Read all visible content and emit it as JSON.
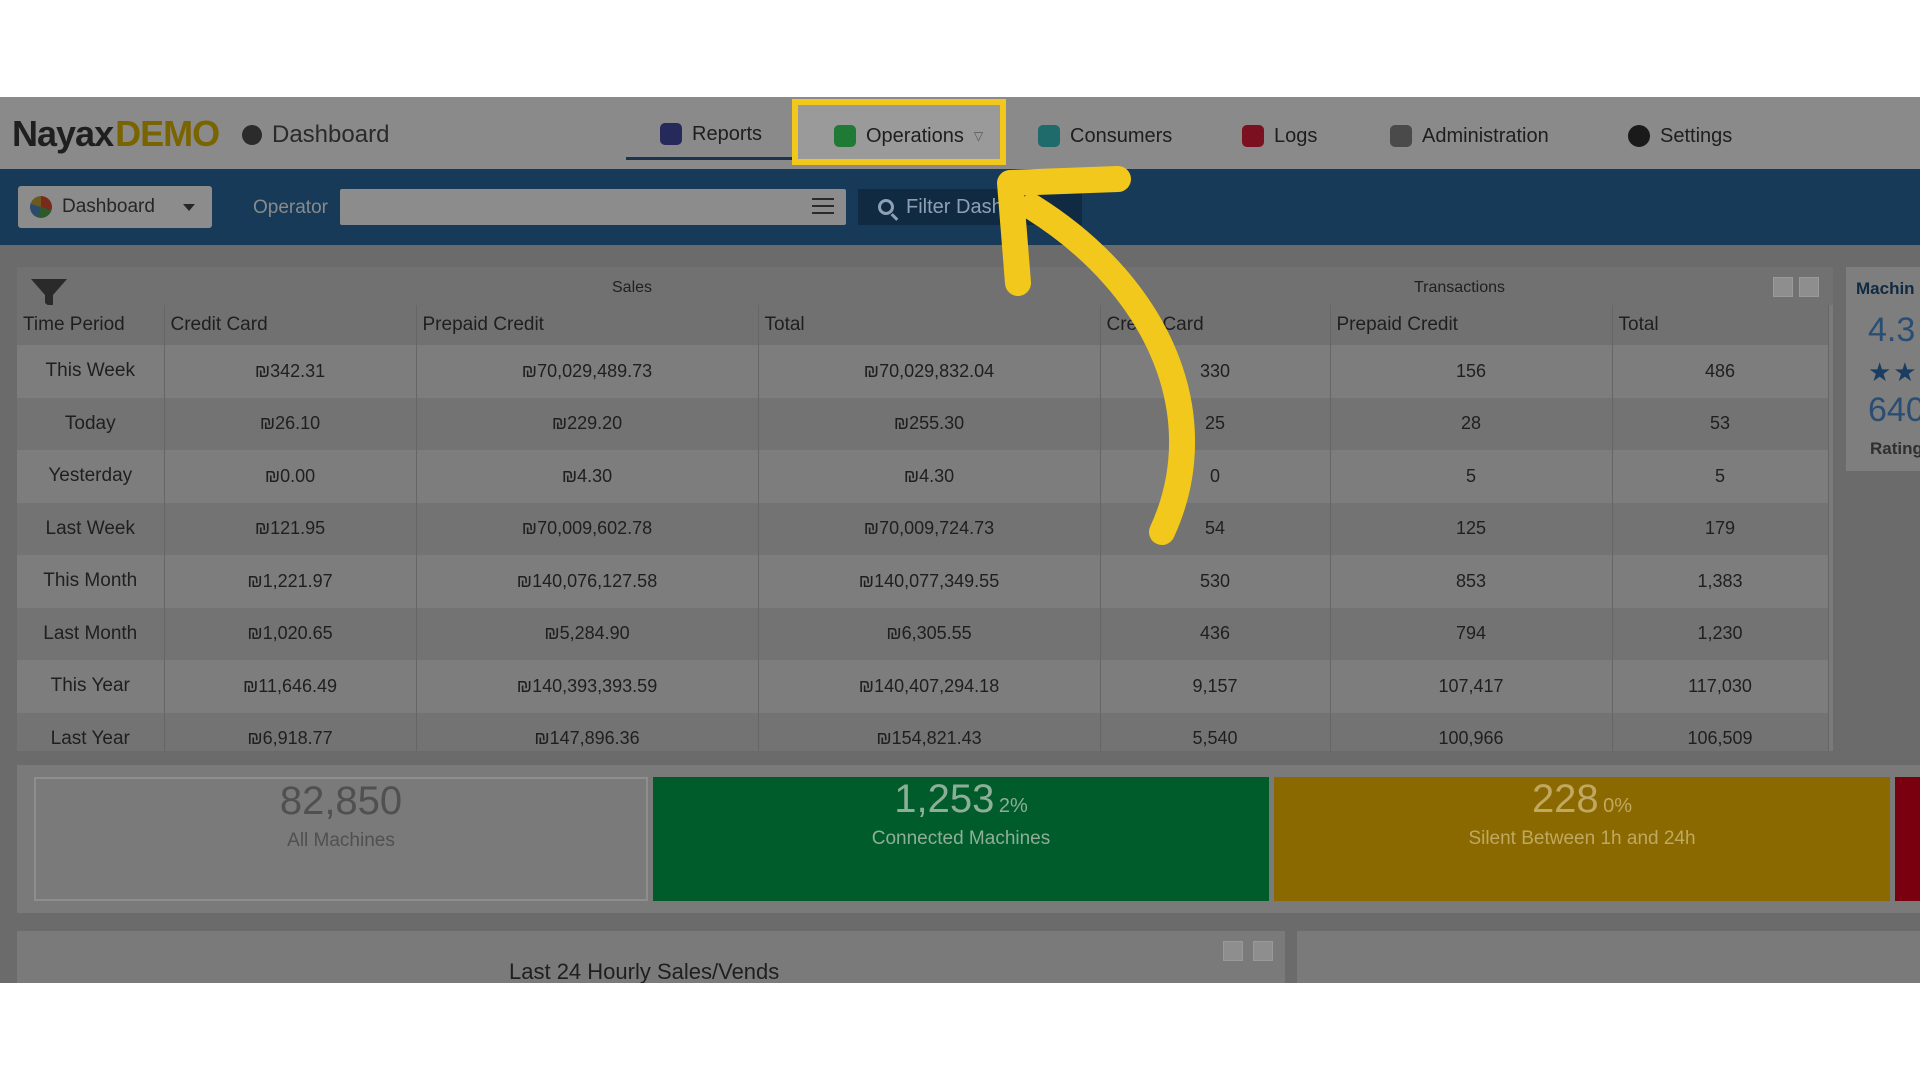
{
  "header": {
    "logo_main": "Nayax",
    "logo_suffix": "DEMO",
    "breadcrumb": "Dashboard"
  },
  "nav": {
    "reports": "Reports",
    "operations": "Operations",
    "consumers": "Consumers",
    "logs": "Logs",
    "administration": "Administration",
    "settings": "Settings"
  },
  "filterbar": {
    "dashboard_button": "Dashboard",
    "operator_label": "Operator",
    "operator_value": "",
    "filter_button": "Filter Dash"
  },
  "table": {
    "group_sales": "Sales",
    "group_transactions": "Transactions",
    "columns": [
      "Time Period",
      "Credit Card",
      "Prepaid Credit",
      "Total",
      "Credit Card",
      "Prepaid Credit",
      "Total"
    ],
    "rows": [
      [
        "This Week",
        "₪342.31",
        "₪70,029,489.73",
        "₪70,029,832.04",
        "330",
        "156",
        "486"
      ],
      [
        "Today",
        "₪26.10",
        "₪229.20",
        "₪255.30",
        "25",
        "28",
        "53"
      ],
      [
        "Yesterday",
        "₪0.00",
        "₪4.30",
        "₪4.30",
        "0",
        "5",
        "5"
      ],
      [
        "Last Week",
        "₪121.95",
        "₪70,009,602.78",
        "₪70,009,724.73",
        "54",
        "125",
        "179"
      ],
      [
        "This Month",
        "₪1,221.97",
        "₪140,076,127.58",
        "₪140,077,349.55",
        "530",
        "853",
        "1,383"
      ],
      [
        "Last Month",
        "₪1,020.65",
        "₪5,284.90",
        "₪6,305.55",
        "436",
        "794",
        "1,230"
      ],
      [
        "This Year",
        "₪11,646.49",
        "₪140,393,393.59",
        "₪140,407,294.18",
        "9,157",
        "107,417",
        "117,030"
      ],
      [
        "Last Year",
        "₪6,918.77",
        "₪147,896.36",
        "₪154,821.43",
        "5,540",
        "100,966",
        "106,509"
      ]
    ]
  },
  "rating": {
    "title": "Machin",
    "value": "4.3",
    "stars": "★★",
    "count": "640",
    "label": "Rating"
  },
  "cards": [
    {
      "number": "82,850",
      "percent": "",
      "label": "All Machines",
      "bg": "#7a7a7a",
      "color": "#505050"
    },
    {
      "number": "1,253",
      "percent": "2%",
      "label": "Connected Machines",
      "bg": "#005c2a",
      "color": "#8fae99"
    },
    {
      "number": "228",
      "percent": "0%",
      "label": "Silent Between 1h and 24h",
      "bg": "#8a6a00",
      "color": "#c0a860"
    }
  ],
  "bottom": {
    "chart_title": "Last 24 Hourly Sales/Vends"
  },
  "colors": {
    "highlight": "#f3c81c",
    "filterbar": "#163a58"
  }
}
